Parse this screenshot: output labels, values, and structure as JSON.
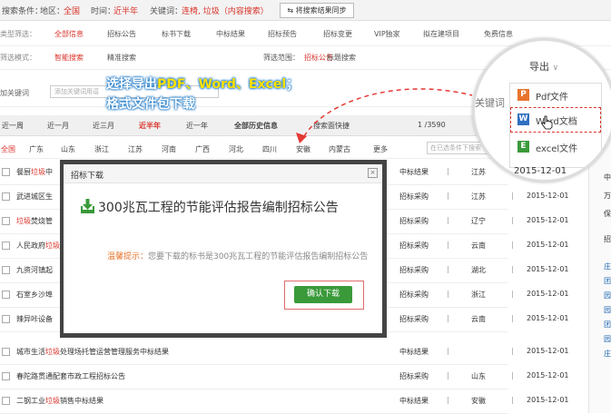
{
  "topbar": {
    "condition_label": "搜索条件：",
    "region_label": "地区：",
    "region_value": "全国",
    "time_label": "时间：",
    "time_value": "近半年",
    "keyword_label": "关键词：",
    "keyword_value": "连椅, 垃圾（内容搜索）",
    "sync_button": "将搜索结果同步"
  },
  "filters": {
    "type_label": "类型筛选：",
    "type_items": [
      "全部信息",
      "招标公告",
      "标书下载",
      "中标结果",
      "招标预告",
      "招标变更",
      "VIP独家",
      "拟在建项目",
      "免费信息"
    ],
    "mode_label": "筛选模式：",
    "mode_items": [
      "智能搜索",
      "精准搜索"
    ],
    "scope_label": "筛选范围：",
    "scope_items": [
      "招标公告",
      "标题搜索"
    ]
  },
  "search": {
    "add_keyword_label": "加关键词",
    "add_keyword_placeholder": "添加关键词用逗"
  },
  "time_tabs": [
    "近一周",
    "近一月",
    "近三月",
    "近半年",
    "近一年",
    "全部历史信息"
  ],
  "time_tabs_active": "近半年",
  "time_tab_extra": "搜索面快捷",
  "page_counter": "1 /3590",
  "region_tabs": [
    "全国",
    "广东",
    "山东",
    "浙江",
    "江苏",
    "河南",
    "广西",
    "河北",
    "四川",
    "安徽",
    "内蒙古",
    "更多"
  ],
  "region_search_placeholder": "在已选条件下搜索",
  "rows": [
    {
      "title_pre": "餐厨",
      "title_hl": "垃圾",
      "title_post": "中",
      "type": "中标结果",
      "region": "江苏",
      "date": "2015-12-01"
    },
    {
      "title_pre": "武进城区生",
      "title_hl": "",
      "title_post": "",
      "type": "招标采购",
      "region": "江苏",
      "date": "2015-12-01"
    },
    {
      "title_pre": "",
      "title_hl": "垃圾",
      "title_post": "焚烧管",
      "type": "招标采购",
      "region": "辽宁",
      "date": "2015-12-01"
    },
    {
      "title_pre": "人民政府",
      "title_hl": "垃圾",
      "title_post": "",
      "type": "招标采购",
      "region": "云南",
      "date": "2015-12-01"
    },
    {
      "title_pre": "九资河镇起",
      "title_hl": "",
      "title_post": "",
      "type": "招标采购",
      "region": "湖北",
      "date": "2015-12-01"
    },
    {
      "title_pre": "石室乡沙埠",
      "title_hl": "",
      "title_post": "",
      "type": "招标采购",
      "region": "浙江",
      "date": "2015-12-01"
    },
    {
      "title_pre": "辣异咔设备",
      "title_hl": "",
      "title_post": "",
      "type": "招标采购",
      "region": "云南",
      "date": "2015-12-01"
    },
    {
      "title_pre": "城市生活",
      "title_hl": "垃圾",
      "title_post": "处理场托管运营管理服务中标结果",
      "type": "中标结果",
      "region": "",
      "date": "2015-12-01"
    },
    {
      "title_pre": "春陀路贯通配套市政工程招标公告",
      "title_hl": "",
      "title_post": "",
      "type": "招标采购",
      "region": "山东",
      "date": "2015-12-01"
    },
    {
      "title_pre": "二钢工业",
      "title_hl": "垃圾",
      "title_post": "销售中标结果",
      "type": "中标结果",
      "region": "安徽",
      "date": "2015-12-01"
    }
  ],
  "sidebar": {
    "lines": [
      "中",
      "万",
      "保",
      "招",
      "庄",
      "团",
      "园",
      "园",
      "团",
      "园",
      "庄"
    ]
  },
  "callout": {
    "line1_pre": "选择导出",
    "line1_hl": "PDF、Word、Excel",
    "line1_post": "；",
    "line2": "格式文件包下载"
  },
  "magnifier": {
    "export_label": "导出",
    "keyword_fragment": "关键词",
    "items": [
      {
        "label": "Pdf文件",
        "icon": "P",
        "color": "#e8742d"
      },
      {
        "label": "Word文档",
        "icon": "W",
        "color": "#2f6fc0"
      },
      {
        "label": "excel文件",
        "icon": "E",
        "color": "#3a9a3a"
      }
    ],
    "date_fragment": "2015-12-01"
  },
  "modal": {
    "title": "招标下载",
    "close": "×",
    "doc_title": "300兆瓦工程的节能评估报告编制招标公告",
    "hint_label": "温馨提示：",
    "hint_text": "您要下载的标书是300兆瓦工程的节能评估报告编制招标公告",
    "confirm_button": "确认下载"
  }
}
